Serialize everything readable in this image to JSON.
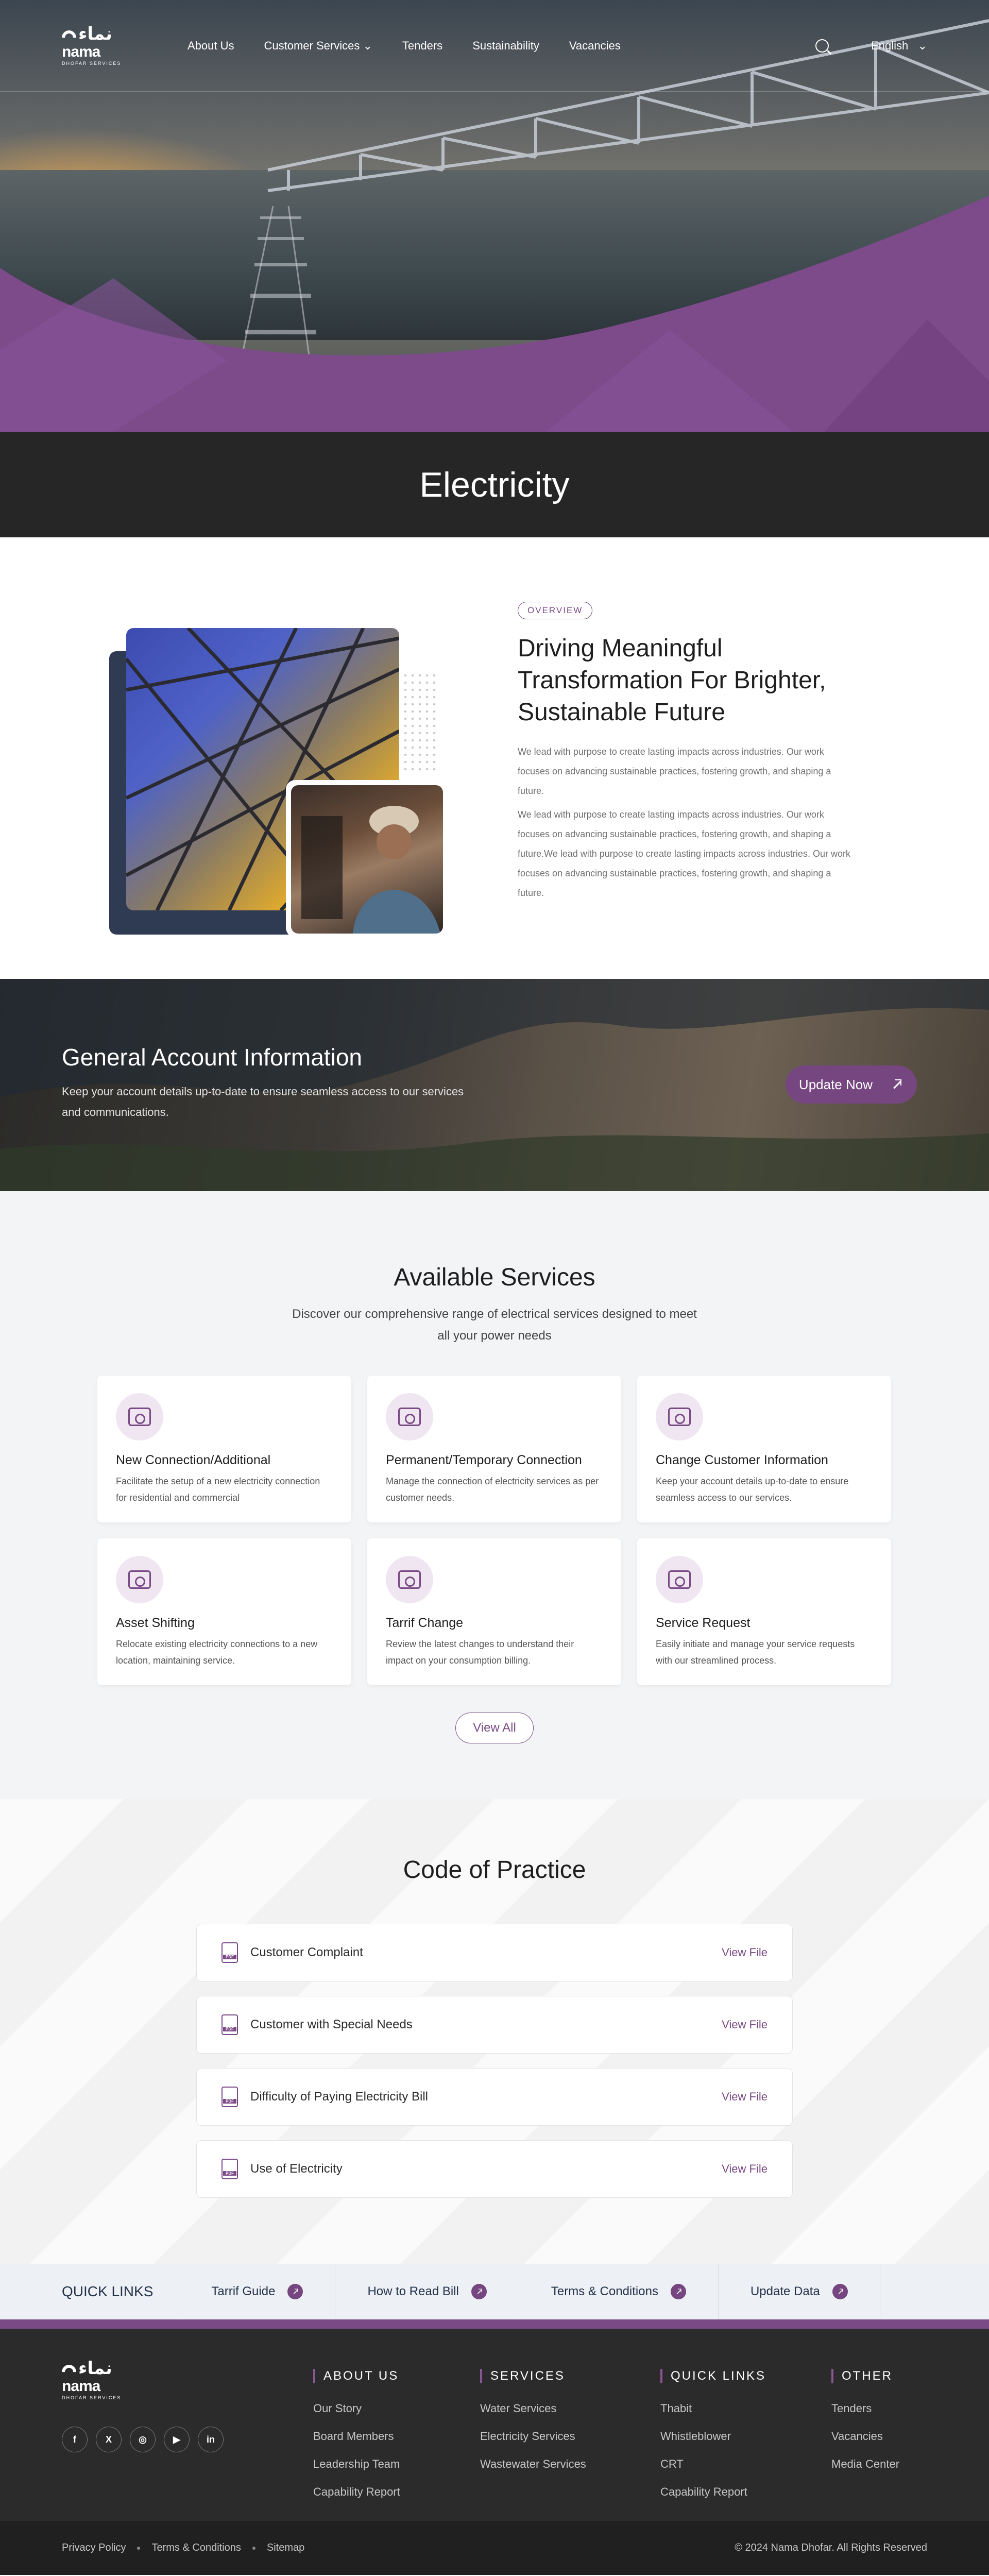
{
  "brand": {
    "logo_ar": "نماء",
    "logo_en": "nama",
    "logo_sub": "DHOFAR SERVICES"
  },
  "nav": {
    "items": [
      "About Us",
      "Customer Services",
      "Tenders",
      "Sustainability",
      "Vacancies"
    ],
    "language": "English"
  },
  "page_title": "Electricity",
  "overview": {
    "tag": "OVERVIEW",
    "heading": "Driving Meaningful Transformation For Brighter, Sustainable Future",
    "para1": "We lead with purpose to create lasting impacts across industries. Our work focuses on advancing sustainable practices, fostering growth, and shaping a future.",
    "para2": "We lead with purpose to create lasting impacts across industries. Our work focuses on advancing sustainable practices, fostering growth, and shaping a future.We lead with purpose to create lasting impacts across industries. Our work focuses on advancing sustainable practices, fostering growth, and shaping a future."
  },
  "account": {
    "title": "General Account Information",
    "text": "Keep your account details up-to-date to ensure seamless access to our services and communications.",
    "button": "Update Now"
  },
  "services": {
    "title": "Available Services",
    "intro": "Discover our comprehensive range of electrical services designed to meet all your power needs",
    "cards": [
      {
        "title": "New Connection/Additional",
        "desc": "Facilitate the setup of a new electricity connection for residential and commercial"
      },
      {
        "title": "Permanent/Temporary Connection",
        "desc": "Manage the connection of electricity services as per customer needs."
      },
      {
        "title": "Change Customer Information",
        "desc": "Keep your account details up-to-date to ensure seamless access to our services."
      },
      {
        "title": "Asset Shifting",
        "desc": "Relocate existing electricity connections to a new location, maintaining service."
      },
      {
        "title": "Tarrif Change",
        "desc": "Review the latest changes to understand their impact on your consumption billing."
      },
      {
        "title": "Service Request",
        "desc": "Easily initiate and manage your service requests with our streamlined process."
      }
    ],
    "view_all": "View All"
  },
  "code_of_practice": {
    "title": "Code of Practice",
    "items": [
      "Customer Complaint",
      "Customer with Special Needs",
      "Difficulty of Paying Electricity Bill",
      "Use of Electricity"
    ],
    "action": "View File"
  },
  "quick_links": {
    "title": "QUICK LINKS",
    "items": [
      "Tarrif Guide",
      "How to Read Bill",
      "Terms & Conditions",
      "Update Data"
    ]
  },
  "footer": {
    "socials": [
      "f",
      "X",
      "◎",
      "▶",
      "in"
    ],
    "columns": [
      {
        "title": "ABOUT US",
        "links": [
          "Our Story",
          "Board Members",
          "Leadership Team",
          "Capability Report"
        ]
      },
      {
        "title": "SERVICES",
        "links": [
          "Water Services",
          "Electricity Services",
          "Wastewater Services"
        ]
      },
      {
        "title": "QUICK LINKS",
        "links": [
          "Thabit",
          "Whistleblower",
          "CRT",
          "Capability Report"
        ]
      },
      {
        "title": "OTHER",
        "links": [
          "Tenders",
          "Vacancies",
          "Media Center"
        ]
      }
    ],
    "bottom_links": [
      "Privacy Policy",
      "Terms & Conditions",
      "Sitemap"
    ],
    "copyright": "© 2024 Nama Dhofar. All Rights Reserved"
  },
  "colors": {
    "brand_purple": "#7a4a86",
    "dark": "#262626",
    "light_bg": "#f3f4f6"
  }
}
